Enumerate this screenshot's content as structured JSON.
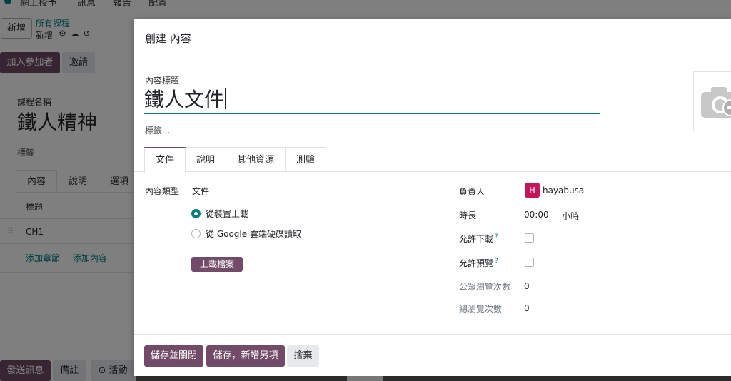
{
  "topbar": {
    "items": [
      "網上授予",
      "訊息",
      "報告",
      "配置"
    ]
  },
  "control_panel": {
    "new_button": "新增",
    "breadcrumb_parent": "所有課程",
    "breadcrumb_current": "新增"
  },
  "status_bar": {
    "primary_button": "加入參加者",
    "secondary_button": "邀請"
  },
  "course_form": {
    "name_label": "課程名稱",
    "name_value": "鐵人精神",
    "tags_placeholder": "標籤",
    "tabs": [
      "內容",
      "說明",
      "選項"
    ],
    "column_header": "標題",
    "section_title": "CH1",
    "add_section": "添加章節",
    "add_content": "添加內容"
  },
  "chatter": {
    "send_message": "發送訊息",
    "log_note": "備註",
    "activity": "活動"
  },
  "modal": {
    "title": "創建 內容",
    "content_title_label": "內容標題",
    "content_title_value": "鐵人文件",
    "tags_placeholder": "標籤...",
    "tabs": [
      "文件",
      "說明",
      "其他資源",
      "測驗"
    ],
    "active_tab": "文件",
    "content_type_label": "內容類型",
    "content_type_value": "文件",
    "source_options": [
      "從裝置上載",
      "從 Google 雲端硬碟讀取"
    ],
    "selected_source": "從裝置上載",
    "upload_button": "上載檔案",
    "responsible_label": "負責人",
    "responsible_avatar": "H",
    "responsible_value": "hayabusa",
    "duration_label": "時長",
    "duration_value": "00:00",
    "duration_unit": "小時",
    "allow_download_label": "允許下載",
    "allow_preview_label": "允許預覽",
    "help_mark": "?",
    "public_views_label": "公眾瀏覽次數",
    "public_views_value": "0",
    "total_views_label": "總瀏覽次數",
    "total_views_value": "0",
    "save_close_button": "儲存並關閉",
    "save_new_button": "儲存，新增另項",
    "discard_button": "捨棄"
  },
  "colors": {
    "brand_primary": "#714b67",
    "accent_teal": "#017e84",
    "avatar_bg": "#c2185b"
  }
}
